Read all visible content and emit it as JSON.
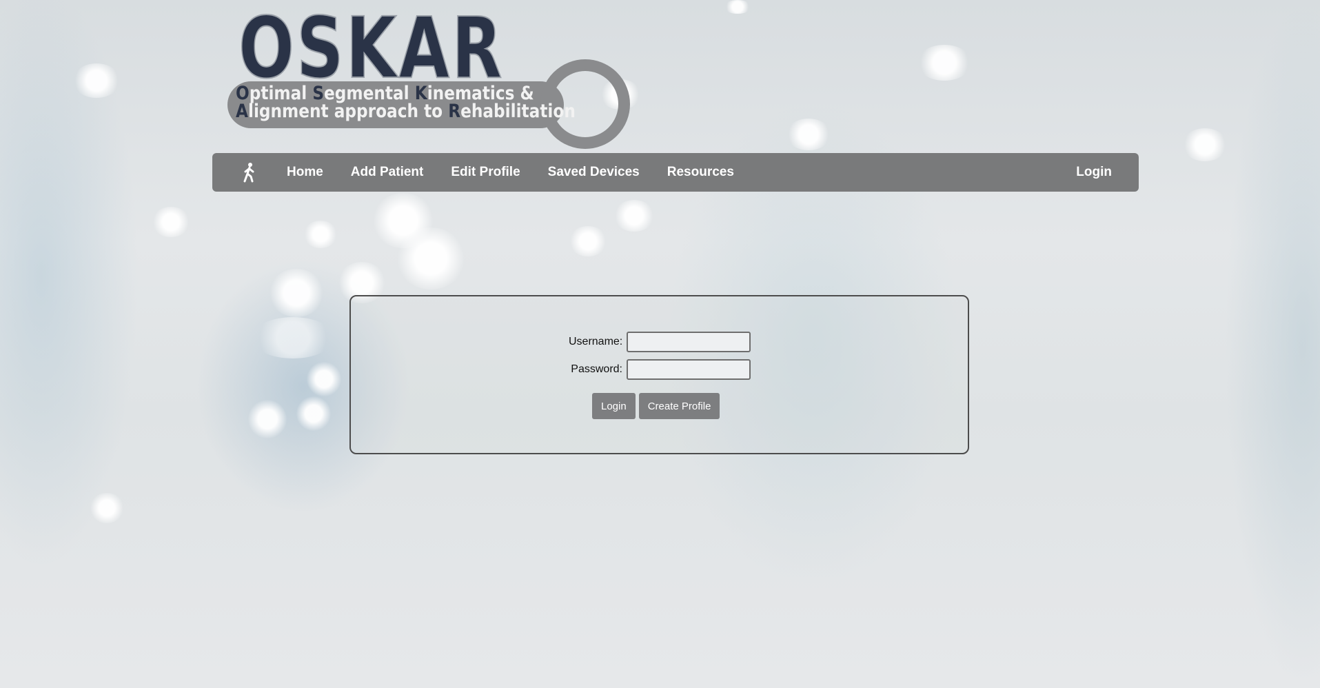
{
  "logo": {
    "word": "OSKAR",
    "line1": [
      {
        "cap": "O",
        "rest": "ptimal "
      },
      {
        "cap": "S",
        "rest": "egmental "
      },
      {
        "cap": "K",
        "rest": "inematics &"
      }
    ],
    "line2": [
      {
        "cap": "A",
        "rest": "lignment approach to "
      },
      {
        "cap": "R",
        "rest": "ehabilitation"
      }
    ]
  },
  "nav": {
    "icon": "walking-person-icon",
    "items": [
      {
        "label": "Home"
      },
      {
        "label": "Add Patient"
      },
      {
        "label": "Edit Profile"
      },
      {
        "label": "Saved Devices"
      },
      {
        "label": "Resources"
      }
    ],
    "login_label": "Login"
  },
  "login_form": {
    "username_label": "Username:",
    "username_value": "",
    "password_label": "Password:",
    "password_value": "",
    "login_button": "Login",
    "create_profile_button": "Create Profile"
  },
  "colors": {
    "nav_background": "#797a7b",
    "logo_dark": "#2a3347",
    "button_background": "#7d7e80"
  }
}
